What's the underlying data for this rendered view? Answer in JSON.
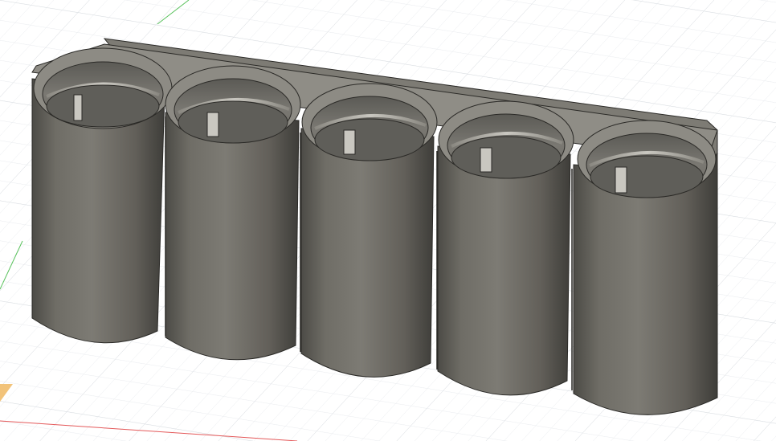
{
  "viewport": {
    "background": "#ffffff",
    "grid_minor_color": "#eef0f2",
    "grid_major_color": "#dfe3e7",
    "model_body_color": "#6f6d66",
    "model_highlight_color": "#a7a59e",
    "model_shadow_color": "#3f3e3a",
    "edge_color": "#2b2a27",
    "axis_x_color": "#e4595a",
    "axis_y_color": "#59c15c",
    "origin_marker_color": "#f2c37a"
  },
  "model": {
    "description_icon": "cylindrical-holder-icon",
    "cup_count": 5
  }
}
